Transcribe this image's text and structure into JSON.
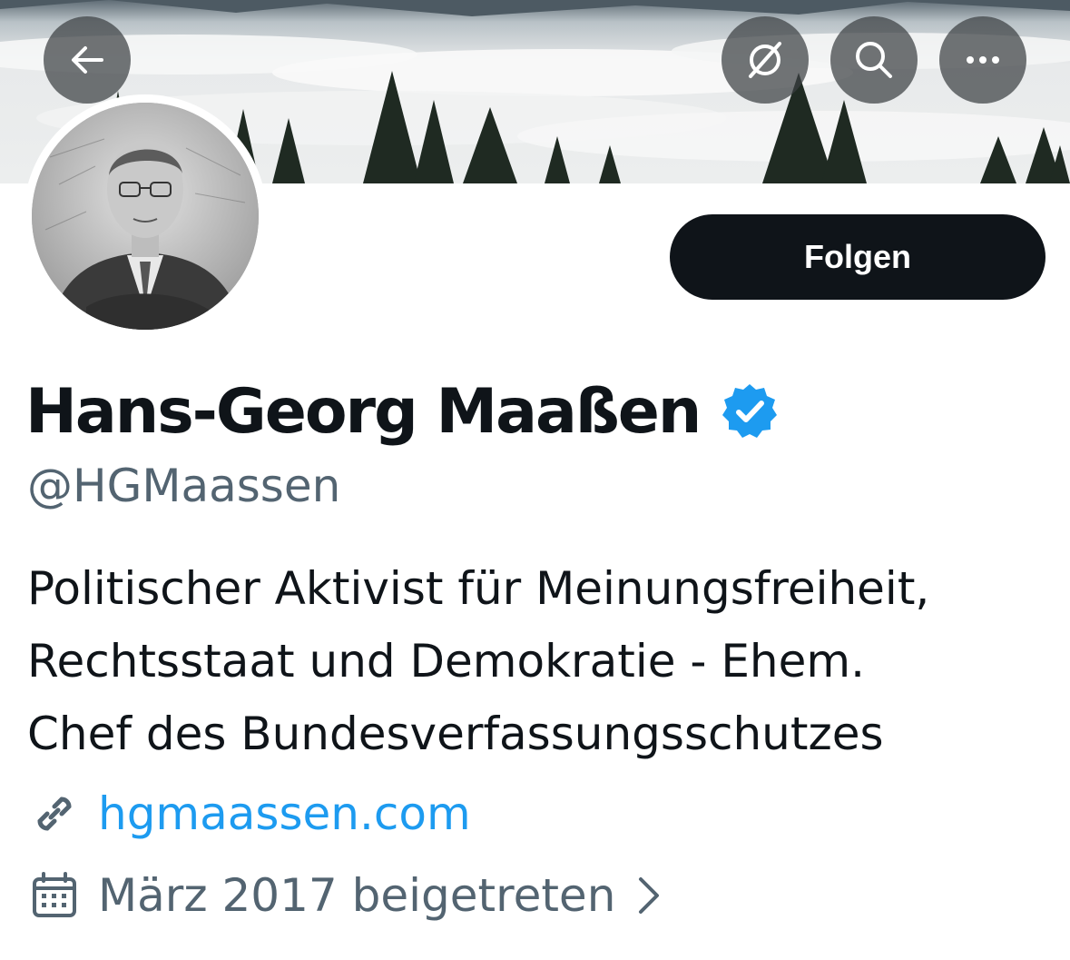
{
  "header": {
    "back_icon": "arrow-left-icon",
    "actions": [
      {
        "name": "notifications-off-icon"
      },
      {
        "name": "search-icon"
      },
      {
        "name": "more-icon"
      }
    ]
  },
  "profile": {
    "display_name": "Hans-Georg Maaßen",
    "verified": true,
    "handle": "@HGMaassen",
    "follow_label": "Folgen",
    "bio_lines": [
      "Politischer Aktivist für Meinungsfreiheit,",
      "Rechtsstaat und Demokratie - Ehem.",
      "Chef des Bundesverfassungsschutzes"
    ],
    "website": "hgmaassen.com",
    "joined": "März 2017 beigetreten"
  },
  "colors": {
    "primary_text": "#0f1419",
    "secondary_text": "#536471",
    "link": "#1d9bf0",
    "verified_badge": "#1d9bf0",
    "button_bg": "#0f1419"
  }
}
